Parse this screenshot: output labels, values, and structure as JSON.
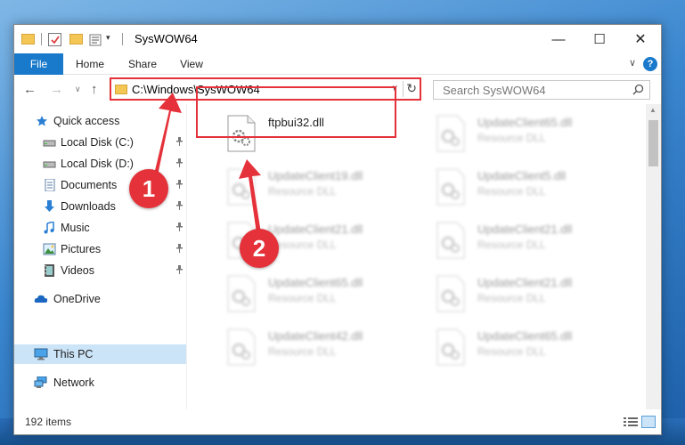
{
  "window": {
    "title": "SysWOW64"
  },
  "titlebar": {
    "quick_access_dropdown": "▾",
    "minimize": "—",
    "maximize": "☐",
    "close": "✕"
  },
  "ribbon": {
    "tabs": [
      "File",
      "Home",
      "Share",
      "View"
    ],
    "expand": "∨",
    "help": "?"
  },
  "navbar": {
    "back": "←",
    "forward": "→",
    "recent": "∨",
    "up": "↑",
    "address": "C:\\Windows\\SysWOW64",
    "address_dropdown": "∨",
    "refresh": "↻",
    "search_placeholder": "Search SysWOW64"
  },
  "navpane": {
    "quick_access": "Quick access",
    "items": [
      {
        "label": "Local Disk (C:)",
        "icon": "drive-icon",
        "pinned": true
      },
      {
        "label": "Local Disk (D:)",
        "icon": "drive-icon",
        "pinned": true
      },
      {
        "label": "Documents",
        "icon": "documents-icon",
        "pinned": true
      },
      {
        "label": "Downloads",
        "icon": "downloads-icon",
        "pinned": true
      },
      {
        "label": "Music",
        "icon": "music-icon",
        "pinned": true
      },
      {
        "label": "Pictures",
        "icon": "pictures-icon",
        "pinned": true
      },
      {
        "label": "Videos",
        "icon": "videos-icon",
        "pinned": true
      }
    ],
    "pin_glyph": "📌",
    "onedrive": "OneDrive",
    "this_pc": "This PC",
    "network": "Network"
  },
  "files": {
    "highlighted": {
      "name": "ftpbui32.dll"
    },
    "blurred": [
      {
        "name": "UpdateClient65.dll",
        "type": "Resource DLL"
      },
      {
        "name": "UpdateClient19.dll",
        "type": "Resource DLL"
      },
      {
        "name": "UpdateClient5.dll",
        "type": "Resource DLL"
      },
      {
        "name": "UpdateClient21.dll",
        "type": "Resource DLL"
      },
      {
        "name": "UpdateClient21.dll",
        "type": "Resource DLL"
      },
      {
        "name": "UpdateClient65.dll",
        "type": "Resource DLL"
      },
      {
        "name": "UpdateClient21.dll",
        "type": "Resource DLL"
      },
      {
        "name": "UpdateClient42.dll",
        "type": "Resource DLL"
      },
      {
        "name": "UpdateClient65.dll",
        "type": "Resource DLL"
      }
    ]
  },
  "statusbar": {
    "item_count": "192 items"
  },
  "annotations": {
    "step1": "1",
    "step2": "2",
    "color": "#e5313a"
  },
  "colors": {
    "accent": "#1979ca",
    "selection": "#cce4f7",
    "annotation_red": "#e5313a"
  }
}
